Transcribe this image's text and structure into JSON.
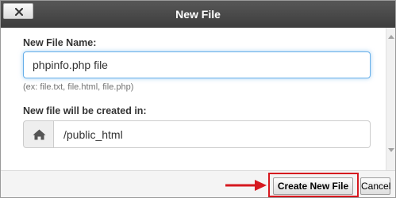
{
  "dialog": {
    "title": "New File",
    "close_icon": "close-icon"
  },
  "form": {
    "name_label": "New File Name:",
    "name_value": "phpinfo.php file",
    "name_hint": "(ex: file.txt, file.html, file.php)",
    "path_label": "New file will be created in:",
    "path_icon": "home-icon",
    "path_value": "/public_html"
  },
  "footer": {
    "create_label": "Create New File",
    "cancel_label": "Cancel"
  },
  "colors": {
    "titlebar": "#4a4a4a",
    "focus_border": "#66afe9",
    "annotation_red": "#d6181f"
  }
}
